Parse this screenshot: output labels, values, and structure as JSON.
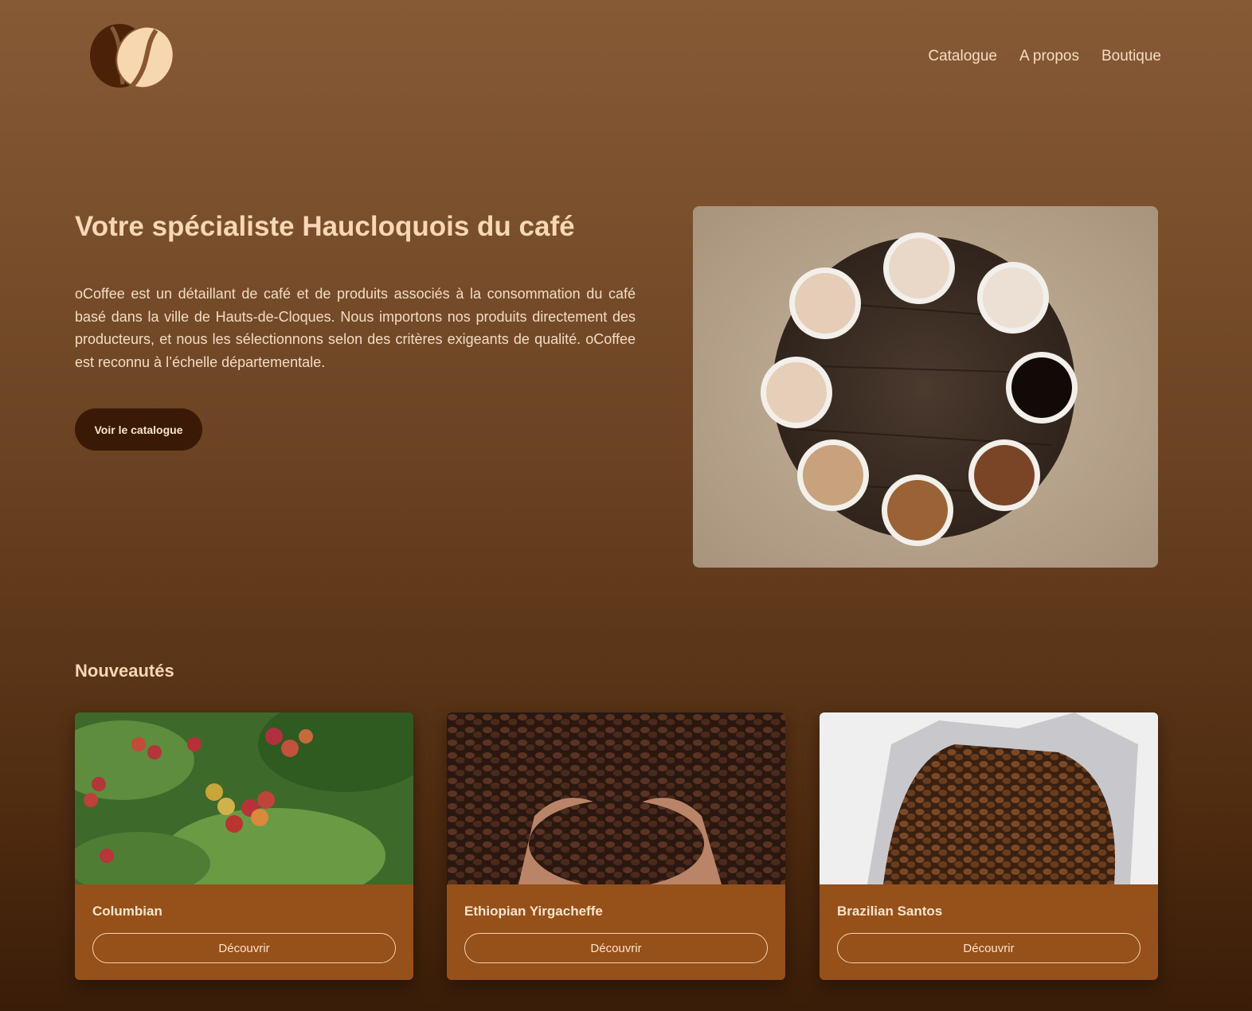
{
  "brand": {
    "logo_icon": "coffee-bean-icon"
  },
  "nav": {
    "items": [
      {
        "label": "Catalogue"
      },
      {
        "label": "A propos"
      },
      {
        "label": "Boutique"
      }
    ]
  },
  "hero": {
    "title": "Votre spécialiste Haucloquois du café",
    "text": "oCoffee est un détaillant de café et de produits associés à la consommation du café basé dans la ville de Hauts-de-Cloques. Nous importons nos produits directement des producteurs, et nous les sélectionnons selon des critères exigeants de qualité. oCoffee est reconnu à l’échelle départementale.",
    "cta_label": "Voir le catalogue",
    "image": "coffee-cups-on-table"
  },
  "new_section": {
    "title": "Nouveautés",
    "cards": [
      {
        "name": "Columbian",
        "button": "Découvrir",
        "image": "coffee-cherries-plant"
      },
      {
        "name": "Ethiopian Yirgacheffe",
        "button": "Découvrir",
        "image": "hands-holding-beans"
      },
      {
        "name": "Brazilian Santos",
        "button": "Découvrir",
        "image": "bag-of-beans"
      }
    ]
  },
  "colors": {
    "background_top": "#875a36",
    "background_bottom": "#3a1d08",
    "accent_text": "#f8d7b4",
    "card": "#96501a",
    "cta": "#3a1a06"
  }
}
